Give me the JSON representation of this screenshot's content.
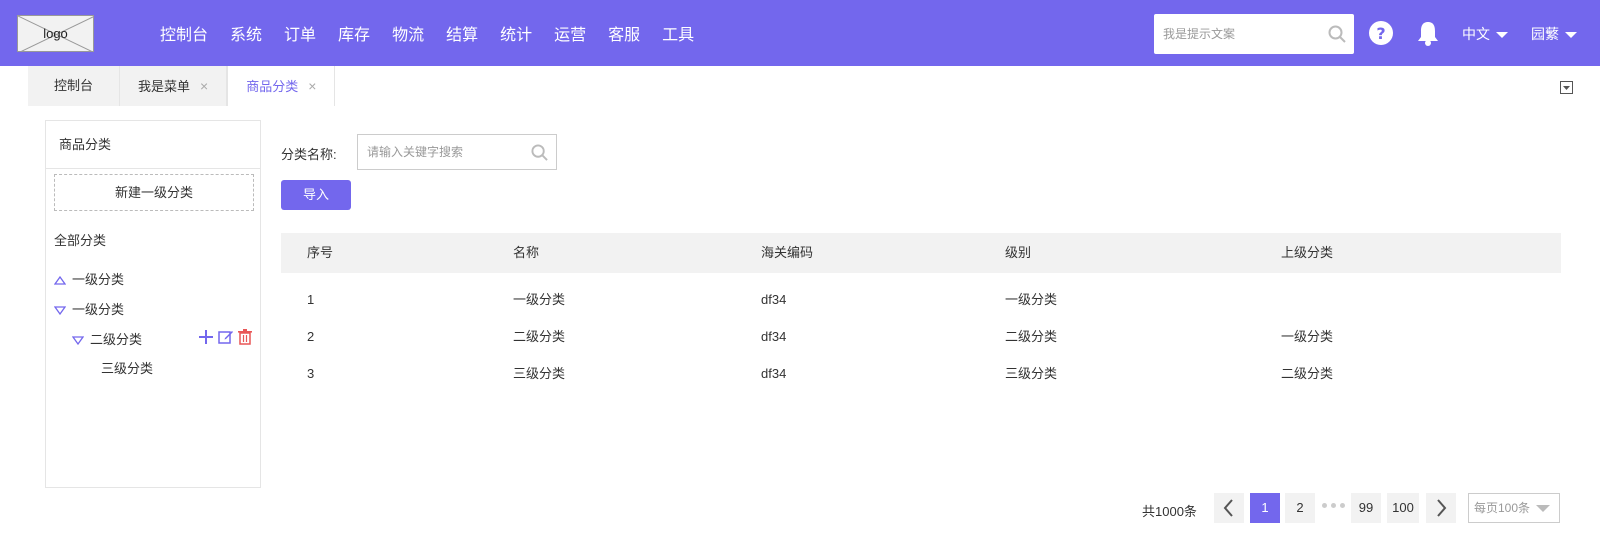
{
  "header": {
    "logo_text": "logo",
    "nav": [
      "控制台",
      "系统",
      "订单",
      "库存",
      "物流",
      "结算",
      "统计",
      "运营",
      "客服",
      "工具"
    ],
    "search_placeholder": "我是提示文案",
    "lang": "中文",
    "user": "园蘩",
    "accent": "#7367ed"
  },
  "tabs": {
    "dashboard": "控制台",
    "my_menu": "我是菜单",
    "category": "商品分类",
    "close": "×"
  },
  "sidebar": {
    "title": "商品分类",
    "new_button": "新建一级分类",
    "all_label": "全部分类",
    "tree": {
      "item1": "一级分类",
      "item2": "一级分类",
      "item3": "二级分类",
      "item4": "三级分类"
    }
  },
  "filter": {
    "label": "分类名称:",
    "placeholder": "请输入关键字搜索",
    "import_button": "导入"
  },
  "table": {
    "headers": [
      "序号",
      "名称",
      "海关编码",
      "级别",
      "上级分类"
    ],
    "rows": [
      [
        "1",
        "一级分类",
        "df34",
        "一级分类",
        ""
      ],
      [
        "2",
        "二级分类",
        "df34",
        "二级分类",
        "一级分类"
      ],
      [
        "3",
        "三级分类",
        "df34",
        "三级分类",
        "二级分类"
      ]
    ]
  },
  "pagination": {
    "total": "共1000条",
    "pages": [
      "1",
      "2",
      "99",
      "100"
    ],
    "per_page": "每页100条"
  }
}
